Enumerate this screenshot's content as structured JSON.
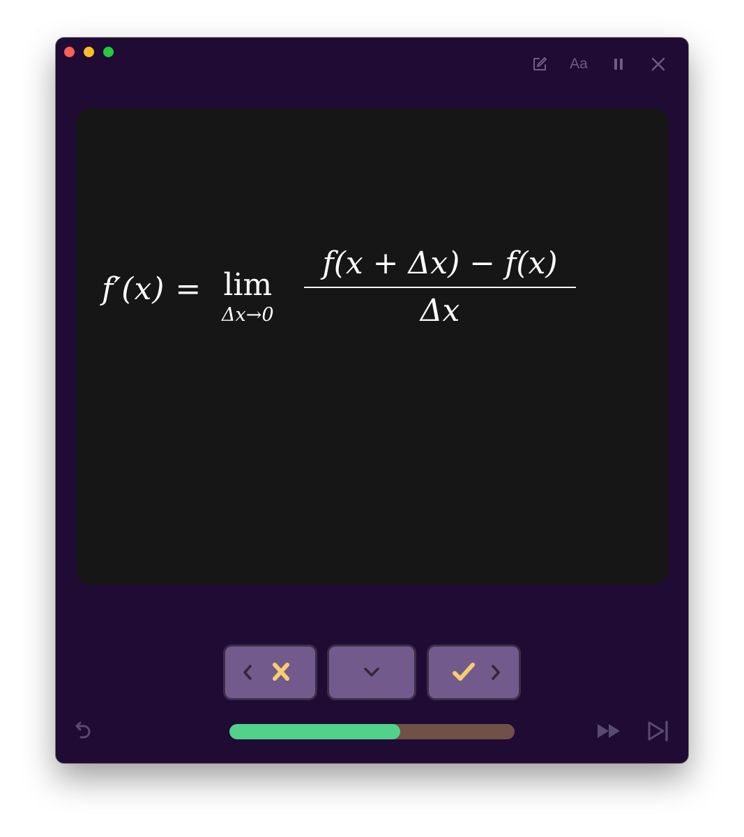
{
  "window": {
    "toolbar": {
      "edit_icon": "edit-icon",
      "font_label": "Aa",
      "pause_icon": "pause-icon",
      "close_icon": "close-icon"
    }
  },
  "card": {
    "formula": {
      "lhs": "f′(x) =",
      "lim": "lim",
      "lim_sub": "Δx→0",
      "numerator": "f(x + Δx) − f(x)",
      "denominator": "Δx"
    }
  },
  "controls": {
    "previous_icon": "chevron-left-icon",
    "wrong_icon": "x-icon",
    "flip_icon": "chevron-down-icon",
    "correct_icon": "check-icon",
    "next_icon": "chevron-right-icon"
  },
  "progress": {
    "fraction": 0.6
  },
  "footer": {
    "undo_icon": "undo-icon",
    "fast_forward_icon": "fast-forward-icon",
    "skip_icon": "skip-end-icon"
  },
  "colors": {
    "window_bg": "#1f0b33",
    "card_bg": "#161616",
    "button_bg": "#735a8c",
    "accent_yellow": "#f7cd71",
    "progress_fill": "#52d18b",
    "progress_track": "#6f5148",
    "muted_icon": "#6d5e80"
  }
}
